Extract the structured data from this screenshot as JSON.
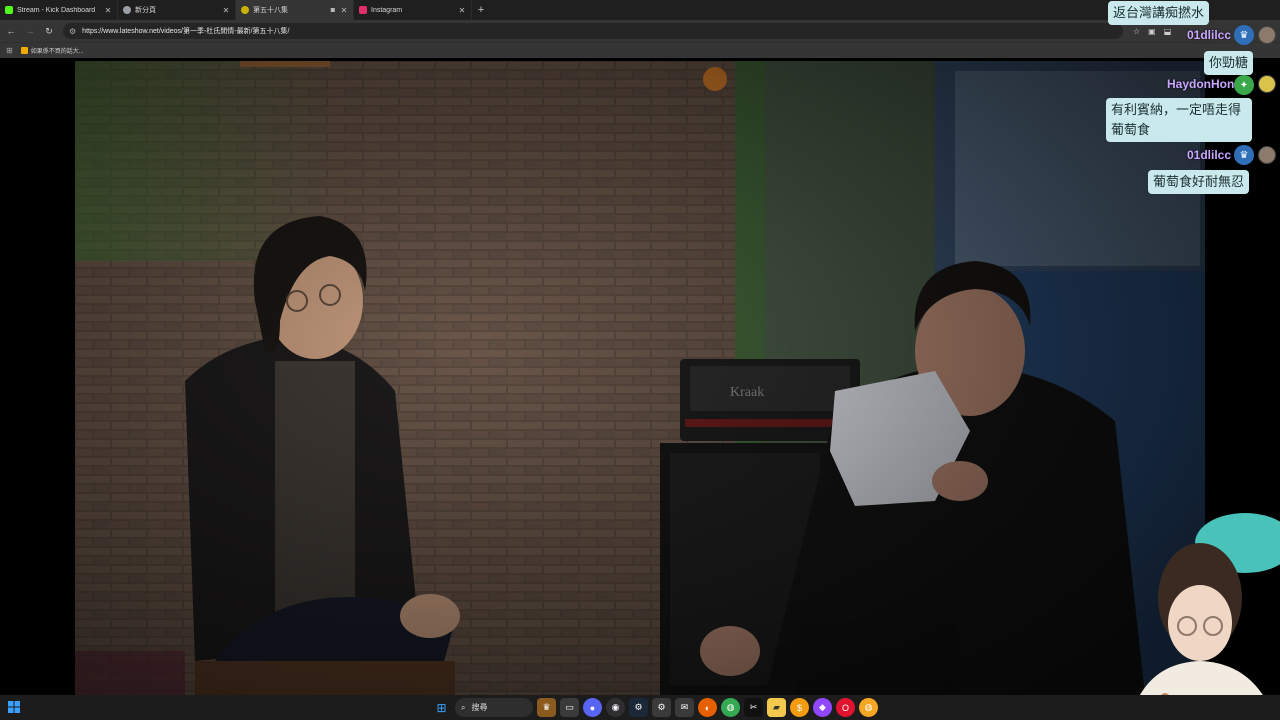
{
  "browser": {
    "tabs": [
      {
        "label": "Stream - Kick Dashboard",
        "favicon_color": "#53fc18",
        "active": false
      },
      {
        "label": "新分頁",
        "favicon_color": "#9aa0a6",
        "active": false
      },
      {
        "label": "第五十八集",
        "favicon_color": "#c9b200",
        "active": true
      },
      {
        "label": "Instagram",
        "favicon_color": "#e1306c",
        "active": false
      }
    ],
    "url": "https://www.lateshow.net/videos/第一季-杜氏閒情-最新/第五十八集/",
    "bookmark_label": "如果係不買的話大..."
  },
  "chat": {
    "messages": [
      {
        "text": "返台灣講痴撚水"
      },
      {
        "user": "01dlilcc",
        "text": "你勁糖"
      },
      {
        "user": "HaydonHon",
        "text": "有利賓納，一定唔走得 葡萄食"
      },
      {
        "user": "01dlilcc",
        "text": "葡萄食好耐無忍"
      }
    ],
    "colors": {
      "bubble": "#c9e9ec",
      "username": "#c8a6ff"
    }
  },
  "taskbar": {
    "search_label": "搜尋"
  }
}
